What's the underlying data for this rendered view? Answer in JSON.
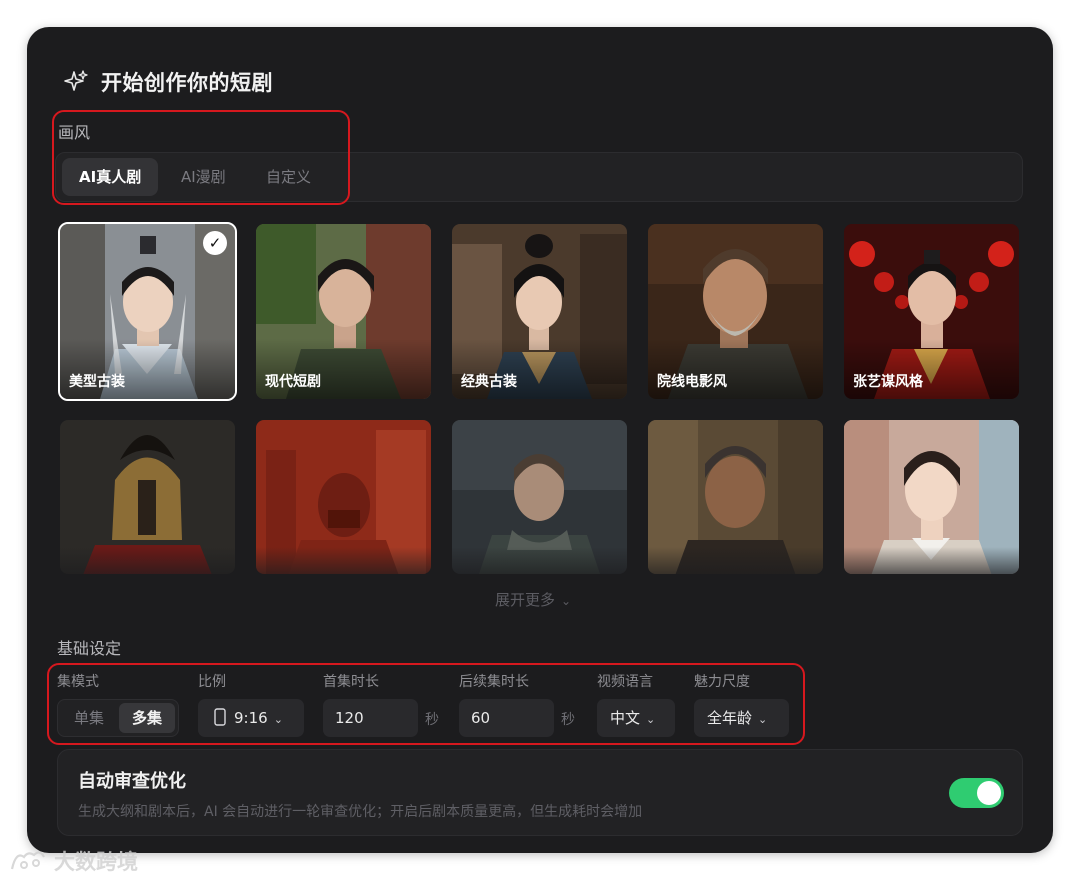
{
  "header": {
    "title": "开始创作你的短剧",
    "icon": "sparkle-icon"
  },
  "style_section": {
    "label": "画风",
    "tabs": [
      {
        "label": "AI真人剧",
        "active": true
      },
      {
        "label": "AI漫剧",
        "active": false
      },
      {
        "label": "自定义",
        "active": false
      }
    ]
  },
  "styles": [
    {
      "label": "美型古装",
      "selected": true
    },
    {
      "label": "现代短剧",
      "selected": false
    },
    {
      "label": "经典古装",
      "selected": false
    },
    {
      "label": "院线电影风",
      "selected": false
    },
    {
      "label": "张艺谋风格",
      "selected": false
    }
  ],
  "expand_more": "展开更多",
  "basic_settings": {
    "label": "基础设定",
    "episode_mode": {
      "label": "集模式",
      "options": [
        "单集",
        "多集"
      ],
      "selected": "多集"
    },
    "ratio": {
      "label": "比例",
      "value": "9:16"
    },
    "first_duration": {
      "label": "首集时长",
      "value": "120",
      "unit": "秒"
    },
    "next_duration": {
      "label": "后续集时长",
      "value": "60",
      "unit": "秒"
    },
    "language": {
      "label": "视频语言",
      "value": "中文"
    },
    "rating": {
      "label": "魅力尺度",
      "value": "全年龄"
    }
  },
  "auto_review": {
    "title": "自动审查优化",
    "description": "生成大纲和剧本后，AI 会自动进行一轮审查优化；开启后剧本质量更高，但生成耗时会增加",
    "enabled": true
  },
  "watermark": "大数跨境",
  "colors": {
    "accent_red": "#d6181e",
    "toggle_on": "#2fcc71",
    "card_bg": "#1c1c1e"
  }
}
